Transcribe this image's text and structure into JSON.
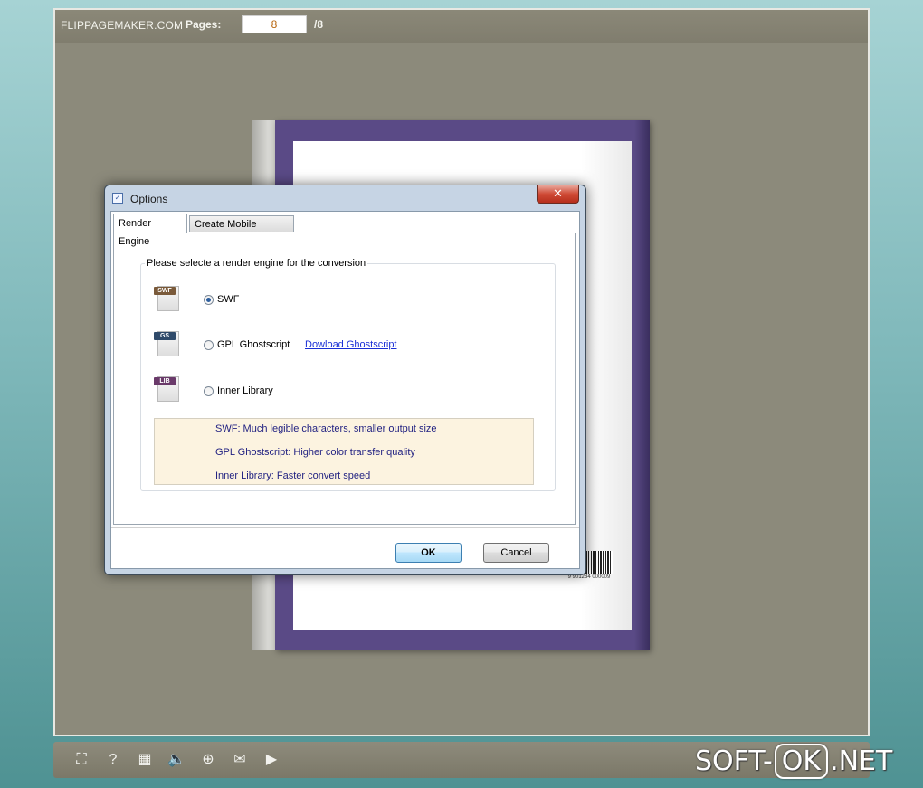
{
  "viewer": {
    "brand": "FLIPPAGEMAKER.COM",
    "pages_label": "Pages:",
    "current_page": "8",
    "total_pages": "/8"
  },
  "book": {
    "barcode_number": "9 901234 000009"
  },
  "dialog": {
    "title": "Options",
    "close_label": "✕",
    "tabs": [
      {
        "label": "Render Engine",
        "active": true
      },
      {
        "label": "Create Mobile Version",
        "active": false
      }
    ],
    "group_title": "Please selecte a render engine for the conversion",
    "engines": [
      {
        "icon": "swf-file-icon",
        "tag": "SWF",
        "tag_color": "#7a5a3a",
        "label": "SWF",
        "selected": true
      },
      {
        "icon": "gs-file-icon",
        "tag": "GS",
        "tag_color": "#2f4a6a",
        "label": "GPL Ghostscript",
        "selected": false
      },
      {
        "icon": "lib-file-icon",
        "tag": "LIB",
        "tag_color": "#6a3a6a",
        "label": "Inner Library",
        "selected": false
      }
    ],
    "download_link": "Dowload Ghostscript",
    "info": [
      "SWF: Much legible characters, smaller output size",
      "GPL Ghostscript: Higher color transfer quality",
      "Inner Library: Faster convert speed"
    ],
    "ok_label": "OK",
    "cancel_label": "Cancel"
  },
  "toolbar": {
    "icons": [
      "fit-screen-icon",
      "help-icon",
      "thumbnails-icon",
      "sound-icon",
      "zoom-in-icon",
      "email-icon",
      "play-icon"
    ]
  },
  "watermark": {
    "prefix": "SOFT-",
    "ok": "OK",
    "suffix": ".NET"
  }
}
